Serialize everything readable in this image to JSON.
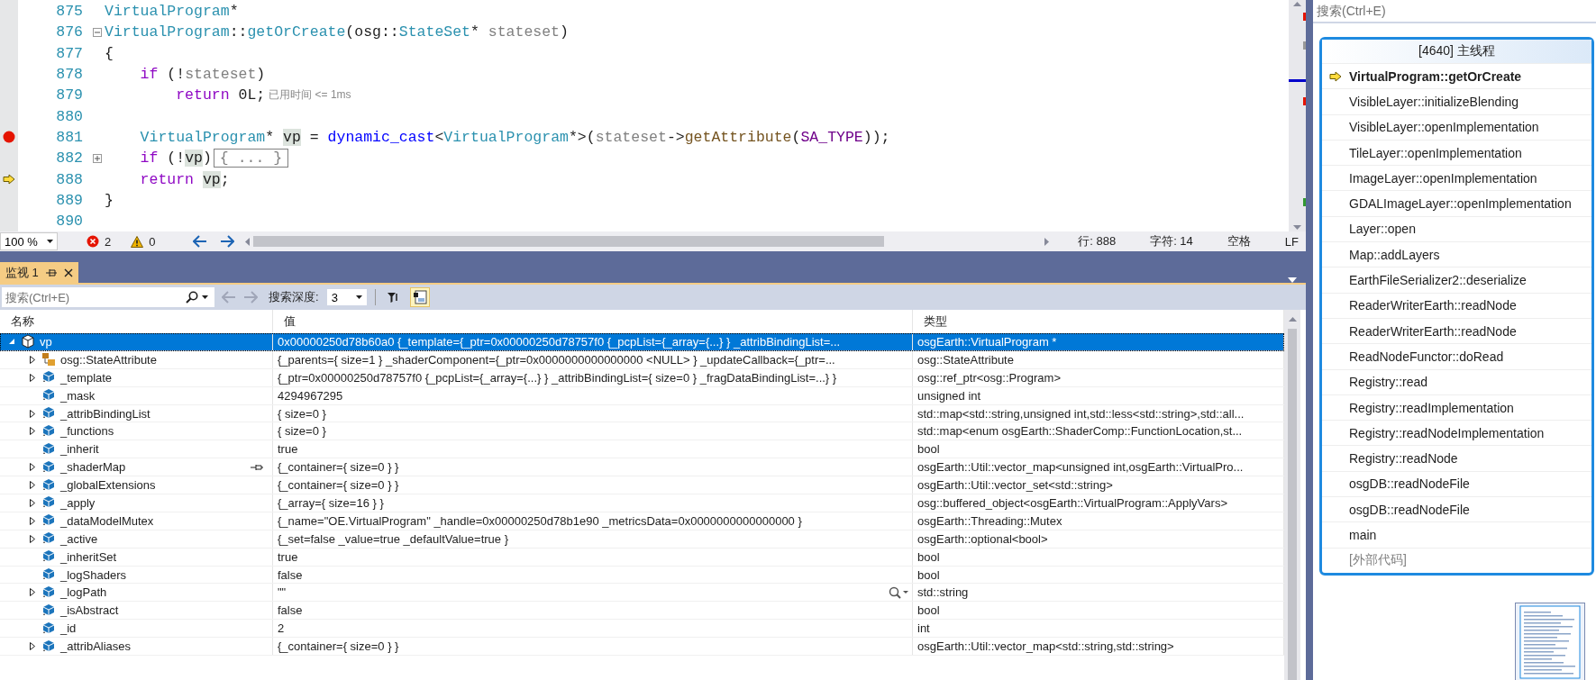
{
  "editor": {
    "lines": [
      {
        "number": "875",
        "breakpoint": false,
        "current": false,
        "tokens": [
          {
            "kind": "type",
            "text": "VirtualProgram"
          },
          {
            "kind": "plain",
            "text": "*"
          }
        ]
      },
      {
        "number": "876",
        "breakpoint": false,
        "current": false,
        "collapsed": false,
        "tokens": [
          {
            "kind": "type",
            "text": "VirtualProgram"
          },
          {
            "kind": "plain",
            "text": "::"
          },
          {
            "kind": "type",
            "text": "getOrCreate"
          },
          {
            "kind": "plain",
            "text": "(osg::"
          },
          {
            "kind": "type",
            "text": "StateSet"
          },
          {
            "kind": "plain",
            "text": "* "
          },
          {
            "kind": "param",
            "text": "stateset"
          },
          {
            "kind": "plain",
            "text": ")"
          }
        ]
      },
      {
        "number": "877",
        "breakpoint": false,
        "current": false,
        "tokens": [
          {
            "kind": "plain",
            "text": "{"
          }
        ]
      },
      {
        "number": "878",
        "breakpoint": false,
        "current": false,
        "tokens": [
          {
            "kind": "keyword",
            "text": "    if"
          },
          {
            "kind": "plain",
            "text": " (!"
          },
          {
            "kind": "param",
            "text": "stateset"
          },
          {
            "kind": "plain",
            "text": ")"
          }
        ]
      },
      {
        "number": "879",
        "breakpoint": false,
        "current": false,
        "tokens": [
          {
            "kind": "keyword",
            "text": "        return"
          },
          {
            "kind": "plain",
            "text": " 0L;"
          }
        ],
        "perf_tip": "已用时间 <= 1ms"
      },
      {
        "number": "880",
        "breakpoint": false,
        "current": false
      },
      {
        "number": "881",
        "breakpoint": true,
        "current": false,
        "tokens": [
          {
            "kind": "type",
            "text": "    VirtualProgram"
          },
          {
            "kind": "plain",
            "text": "* "
          },
          {
            "kind": "ref",
            "text": "vp"
          },
          {
            "kind": "plain",
            "text": " = "
          },
          {
            "kind": "operator",
            "text": "dynamic_cast"
          },
          {
            "kind": "plain",
            "text": "<"
          },
          {
            "kind": "type",
            "text": "VirtualProgram"
          },
          {
            "kind": "plain",
            "text": "*>("
          },
          {
            "kind": "param",
            "text": "stateset"
          },
          {
            "kind": "plain",
            "text": "->"
          },
          {
            "kind": "func",
            "text": "getAttribute"
          },
          {
            "kind": "plain",
            "text": "("
          },
          {
            "kind": "macro",
            "text": "SA_TYPE"
          },
          {
            "kind": "plain",
            "text": "));"
          }
        ]
      },
      {
        "number": "882",
        "breakpoint": false,
        "current": false,
        "collapsed": true,
        "tokens": [
          {
            "kind": "keyword",
            "text": "    if"
          },
          {
            "kind": "plain",
            "text": " (!"
          },
          {
            "kind": "ref",
            "text": "vp"
          },
          {
            "kind": "plain",
            "text": ")"
          },
          {
            "kind": "collapsed",
            "text": "{ ... }"
          }
        ]
      },
      {
        "number": "888",
        "breakpoint": false,
        "current": true,
        "tokens": [
          {
            "kind": "keyword",
            "text": "    return "
          },
          {
            "kind": "ref",
            "text": "vp"
          },
          {
            "kind": "plain",
            "text": ";"
          }
        ]
      },
      {
        "number": "889",
        "breakpoint": false,
        "current": false,
        "tokens": [
          {
            "kind": "plain",
            "text": "}"
          }
        ]
      },
      {
        "number": "890",
        "breakpoint": false,
        "current": false
      }
    ],
    "status_bar": {
      "zoom": "100 %",
      "errors": "2",
      "warnings": "0",
      "line": "行: 888",
      "char": "字符: 14",
      "whitespace": "空格",
      "line_ending": "LF"
    }
  },
  "watch": {
    "tab": {
      "label": "监视 1",
      "selected": true
    },
    "search": {
      "placeholder": "搜索(Ctrl+E)"
    },
    "depth_label": "搜索深度:",
    "depth": "3",
    "raw_view": {
      "on": true
    },
    "columns": [
      "名称",
      "值",
      "类型"
    ],
    "rows": [
      {
        "name": "vp",
        "value": "0x00000250d78b60a0 {_template={_ptr=0x00000250d78757f0 {_pcpList={_array={...} } _attribBindingList=...",
        "type": "osgEarth::VirtualProgram *",
        "kind": "object",
        "expandable": true,
        "expanded": true,
        "selected": true,
        "pinned": false,
        "visualizer": false,
        "children": [
          {
            "name": "osg::StateAttribute",
            "value": "{_parents={ size=1 } _shaderComponent={_ptr=0x0000000000000000 <NULL> } _updateCallback={_ptr=...",
            "type": "osg::StateAttribute",
            "kind": "base",
            "expandable": true,
            "expanded": false,
            "selected": false,
            "pinned": false,
            "visualizer": false
          },
          {
            "name": "_template",
            "value": "{_ptr=0x00000250d78757f0 {_pcpList={_array={...} } _attribBindingList={ size=0 } _fragDataBindingList=...} }",
            "type": "osg::ref_ptr<osg::Program>",
            "kind": "field",
            "expandable": true,
            "expanded": false,
            "selected": false,
            "pinned": false,
            "visualizer": false
          },
          {
            "name": "_mask",
            "value": "4294967295",
            "type": "unsigned int",
            "kind": "field",
            "expandable": false,
            "selected": false,
            "pinned": false,
            "visualizer": false
          },
          {
            "name": "_attribBindingList",
            "value": "{ size=0 }",
            "type": "std::map<std::string,unsigned int,std::less<std::string>,std::all...",
            "kind": "field",
            "expandable": true,
            "expanded": false,
            "selected": false,
            "pinned": false,
            "visualizer": false
          },
          {
            "name": "_functions",
            "value": "{ size=0 }",
            "type": "std::map<enum osgEarth::ShaderComp::FunctionLocation,st...",
            "kind": "field",
            "expandable": true,
            "expanded": false,
            "selected": false,
            "pinned": false,
            "visualizer": false
          },
          {
            "name": "_inherit",
            "value": "true",
            "type": "bool",
            "kind": "field",
            "expandable": false,
            "selected": false,
            "pinned": false,
            "visualizer": false
          },
          {
            "name": "_shaderMap",
            "value": "{_container={ size=0 } }",
            "type": "osgEarth::Util::vector_map<unsigned int,osgEarth::VirtualPro...",
            "kind": "field",
            "expandable": true,
            "expanded": false,
            "selected": false,
            "pinned": true,
            "visualizer": false
          },
          {
            "name": "_globalExtensions",
            "value": "{_container={ size=0 } }",
            "type": "osgEarth::Util::vector_set<std::string>",
            "kind": "field",
            "expandable": true,
            "expanded": false,
            "selected": false,
            "pinned": false,
            "visualizer": false
          },
          {
            "name": "_apply",
            "value": "{_array={ size=16 } }",
            "type": "osg::buffered_object<osgEarth::VirtualProgram::ApplyVars>",
            "kind": "field",
            "expandable": true,
            "expanded": false,
            "selected": false,
            "pinned": false,
            "visualizer": false
          },
          {
            "name": "_dataModelMutex",
            "value": "{_name=\"OE.VirtualProgram\" _handle=0x00000250d78b1e90 _metricsData=0x0000000000000000 }",
            "type": "osgEarth::Threading::Mutex",
            "kind": "field",
            "expandable": true,
            "expanded": false,
            "selected": false,
            "pinned": false,
            "visualizer": false
          },
          {
            "name": "_active",
            "value": "{_set=false _value=true _defaultValue=true }",
            "type": "osgEarth::optional<bool>",
            "kind": "field",
            "expandable": true,
            "expanded": false,
            "selected": false,
            "pinned": false,
            "visualizer": false
          },
          {
            "name": "_inheritSet",
            "value": "true",
            "type": "bool",
            "kind": "field",
            "expandable": false,
            "selected": false,
            "pinned": false,
            "visualizer": false
          },
          {
            "name": "_logShaders",
            "value": "false",
            "type": "bool",
            "kind": "field",
            "expandable": false,
            "selected": false,
            "pinned": false,
            "visualizer": false
          },
          {
            "name": "_logPath",
            "value": "\"\"",
            "type": "std::string",
            "kind": "field",
            "expandable": true,
            "expanded": false,
            "selected": false,
            "pinned": false,
            "visualizer": true
          },
          {
            "name": "_isAbstract",
            "value": "false",
            "type": "bool",
            "kind": "field",
            "expandable": false,
            "selected": false,
            "pinned": false,
            "visualizer": false
          },
          {
            "name": "_id",
            "value": "2",
            "type": "int",
            "kind": "field",
            "expandable": false,
            "selected": false,
            "pinned": false,
            "visualizer": false
          },
          {
            "name": "_attribAliases",
            "value": "{_container={ size=0 } }",
            "type": "osgEarth::Util::vector_map<std::string,std::string>",
            "kind": "field",
            "expandable": true,
            "expanded": false,
            "selected": false,
            "pinned": false,
            "visualizer": false
          }
        ]
      }
    ]
  },
  "side": {
    "search": {
      "placeholder": "搜索(Ctrl+E)"
    },
    "call_stack": {
      "title": "[4640] 主线程",
      "frames": [
        {
          "label": "VirtualProgram::getOrCreate",
          "current": true,
          "external": false
        },
        {
          "label": "VisibleLayer::initializeBlending",
          "current": false,
          "external": false
        },
        {
          "label": "VisibleLayer::openImplementation",
          "current": false,
          "external": false
        },
        {
          "label": "TileLayer::openImplementation",
          "current": false,
          "external": false
        },
        {
          "label": "ImageLayer::openImplementation",
          "current": false,
          "external": false
        },
        {
          "label": "GDALImageLayer::openImplementation",
          "current": false,
          "external": false
        },
        {
          "label": "Layer::open",
          "current": false,
          "external": false
        },
        {
          "label": "Map::addLayers",
          "current": false,
          "external": false
        },
        {
          "label": "EarthFileSerializer2::deserialize",
          "current": false,
          "external": false
        },
        {
          "label": "ReaderWriterEarth::readNode",
          "current": false,
          "external": false
        },
        {
          "label": "ReaderWriterEarth::readNode",
          "current": false,
          "external": false
        },
        {
          "label": "ReadNodeFunctor::doRead",
          "current": false,
          "external": false
        },
        {
          "label": "Registry::read",
          "current": false,
          "external": false
        },
        {
          "label": "Registry::readImplementation",
          "current": false,
          "external": false
        },
        {
          "label": "Registry::readNodeImplementation",
          "current": false,
          "external": false
        },
        {
          "label": "Registry::readNode",
          "current": false,
          "external": false
        },
        {
          "label": "osgDB::readNodeFile",
          "current": false,
          "external": false
        },
        {
          "label": "osgDB::readNodeFile",
          "current": false,
          "external": false
        },
        {
          "label": "main",
          "current": false,
          "external": false
        },
        {
          "label": "[外部代码]",
          "current": false,
          "external": true
        }
      ]
    }
  }
}
